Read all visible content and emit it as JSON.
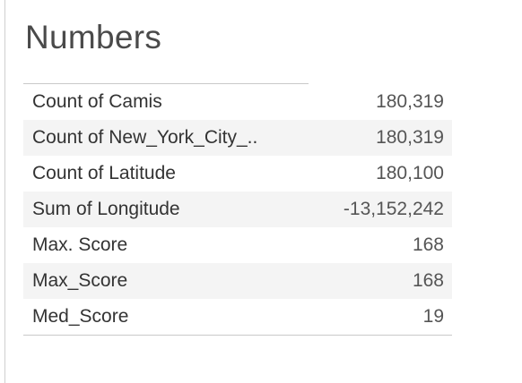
{
  "sheet": {
    "title": "Numbers"
  },
  "measures": [
    {
      "label": "Count of Camis",
      "value": "180,319"
    },
    {
      "label": "Count of New_York_City_..",
      "value": "180,319"
    },
    {
      "label": "Count of Latitude",
      "value": "180,100"
    },
    {
      "label": "Sum of Longitude",
      "value": "-13,152,242"
    },
    {
      "label": "Max. Score",
      "value": "168"
    },
    {
      "label": "Max_Score",
      "value": "168"
    },
    {
      "label": "Med_Score",
      "value": "19"
    }
  ],
  "colors": {
    "row_band": "#f4f4f4",
    "rule": "#c9c9c9",
    "text": "#333333"
  }
}
